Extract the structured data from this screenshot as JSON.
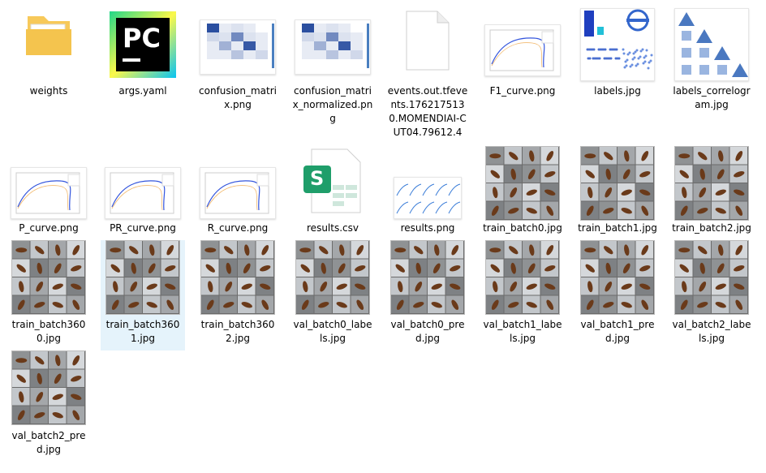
{
  "files": [
    {
      "name": "weights",
      "type": "folder"
    },
    {
      "name": "args.yaml",
      "type": "pycharm"
    },
    {
      "name": "confusion_matrix.png",
      "type": "matrix"
    },
    {
      "name": "confusion_matrix_normalized.png",
      "type": "matrix"
    },
    {
      "name": "events.out.tfevents.1762175130.MOMENDIAI-CUT04.79612.4",
      "type": "blank"
    },
    {
      "name": "F1_curve.png",
      "type": "curve"
    },
    {
      "name": "labels.jpg",
      "type": "labels"
    },
    {
      "name": "labels_correlogram.jpg",
      "type": "correlogram"
    },
    {
      "name": "P_curve.png",
      "type": "curve"
    },
    {
      "name": "PR_curve.png",
      "type": "curve"
    },
    {
      "name": "R_curve.png",
      "type": "curve"
    },
    {
      "name": "results.csv",
      "type": "sheet"
    },
    {
      "name": "results.png",
      "type": "results"
    },
    {
      "name": "train_batch0.jpg",
      "type": "photo"
    },
    {
      "name": "train_batch1.jpg",
      "type": "photo"
    },
    {
      "name": "train_batch2.jpg",
      "type": "photo"
    },
    {
      "name": "train_batch3600.jpg",
      "type": "photo"
    },
    {
      "name": "train_batch3601.jpg",
      "type": "photo",
      "selected": true
    },
    {
      "name": "train_batch3602.jpg",
      "type": "photo"
    },
    {
      "name": "val_batch0_labels.jpg",
      "type": "photo"
    },
    {
      "name": "val_batch0_pred.jpg",
      "type": "photo"
    },
    {
      "name": "val_batch1_labels.jpg",
      "type": "photo"
    },
    {
      "name": "val_batch1_pred.jpg",
      "type": "photo"
    },
    {
      "name": "val_batch2_labels.jpg",
      "type": "photo"
    },
    {
      "name": "val_batch2_pred.jpg",
      "type": "photo"
    }
  ],
  "icons": {
    "folder": "folder-icon",
    "pycharm": "pycharm-icon",
    "matrix": "image-thumbnail-icon",
    "blank": "file-icon",
    "curve": "image-thumbnail-icon",
    "labels": "image-thumbnail-icon",
    "correlogram": "image-thumbnail-icon",
    "sheet": "spreadsheet-icon",
    "results": "image-thumbnail-icon",
    "photo": "image-thumbnail-icon"
  },
  "colors": {
    "selection": "#e5f3fb",
    "folder": "#f4c44e",
    "pycharm_green": "#21d789",
    "sheet_green": "#1f9e6a",
    "chart_blue": "#1f3fbf"
  },
  "pycharm_text": "PC",
  "sheet_text": "S"
}
